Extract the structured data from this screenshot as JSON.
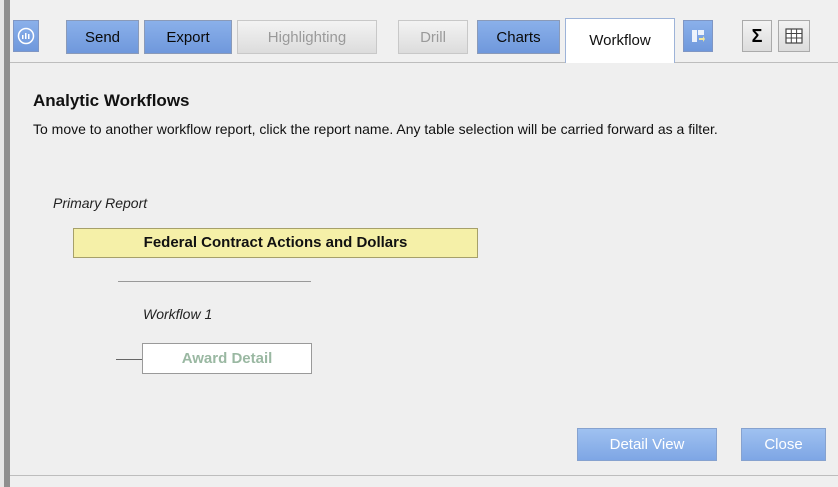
{
  "toolbar": {
    "tabs": [
      {
        "label": "Send",
        "style": "blue"
      },
      {
        "label": "Export",
        "style": "blue"
      },
      {
        "label": "Highlighting",
        "style": "gray"
      },
      {
        "label": "Drill",
        "style": "gray"
      },
      {
        "label": "Charts",
        "style": "blue"
      },
      {
        "label": "Workflow",
        "style": "active"
      }
    ],
    "icons": {
      "menu": "menu-icon",
      "pivot": "pivot-icon",
      "sum": "sum-icon",
      "table": "table-icon"
    },
    "sum_glyph": "Σ"
  },
  "panel": {
    "title": "Analytic Workflows",
    "description": "To move to another workflow report, click the report name. Any table selection will be carried forward as a filter.",
    "primary_label": "Primary Report",
    "primary_report": "Federal Contract Actions and Dollars",
    "workflow_label": "Workflow 1",
    "workflow_report": "Award Detail",
    "detail_view_button": "Detail View",
    "close_button": "Close"
  },
  "colors": {
    "tab_blue": "#7ea6e5",
    "primary_highlight": "#f5f0a8",
    "workflow_text": "#9ab8a2"
  }
}
